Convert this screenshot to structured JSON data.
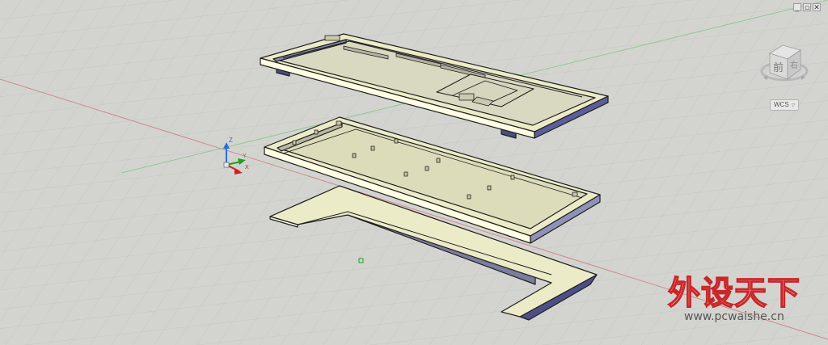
{
  "window_controls": {
    "minimize": "_",
    "restore": "▫",
    "close": "✕"
  },
  "viewcube": {
    "face_label": "前",
    "side_label": "右"
  },
  "wcs_badge": {
    "label": "WCS",
    "caret": "▽"
  },
  "ucs_icon": {
    "z_label": "Z",
    "y_label": "Y",
    "x_label": "X"
  },
  "watermark": {
    "text": "外设天下",
    "url": "www.pcwaishe.cn"
  },
  "colors": {
    "background": "#d3d4d0",
    "grid_line": "#c3c5c1",
    "x_axis": "#c98a8a",
    "y_axis": "#8cc28c",
    "part_top": "#ecebc8",
    "part_light": "#ffffe0",
    "part_shadow": "#5a5d96",
    "part_outline": "#1e1e1e",
    "ucs_z": "#2a6fd6",
    "ucs_y": "#20a020",
    "ucs_x": "#d02020"
  }
}
